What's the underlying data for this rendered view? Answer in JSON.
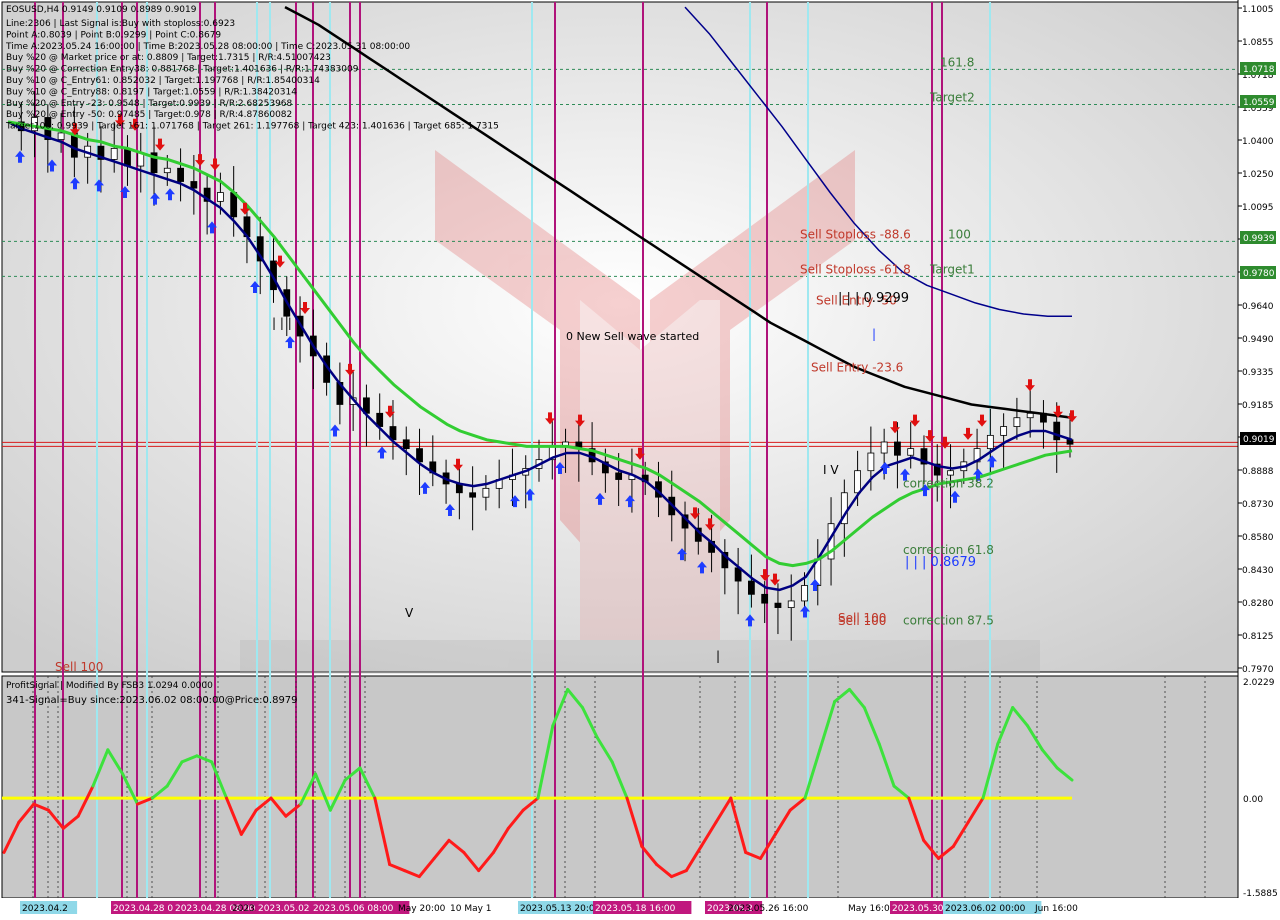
{
  "chart_data": [
    {
      "type": "candlestick",
      "symbol_header": "EOSUSD,H4 0.9149 0.9109 0.8989 0.9019",
      "info_lines": [
        "Line:2306 | Last Signal is:Buy with stoploss:0.6923",
        "Point A:0.8039 | Point B:0.9299 | Point C:0.8679",
        "Time A:2023.05.24 16:00:00 | Time B:2023.05.28 08:00:00 | Time C:2023.05.31 08:00:00",
        "Buy %20 @ Market price or at: 0.8809 | Target:1.7315 | R/R:4.51007423",
        "Buy %20 @ Correction Entry38: 0.881768 | Target:1.401636 | R/R:1.74383009",
        "Buy %10 @ C_Entry61: 0.852032 | Target:1.197768 | R/R:1.85400314",
        "Buy %10 @ C_Entry88: 0.8197 | Target:1.0559 | R/R:1.38420314",
        "Buy %20 @ Entry -23: 0.9548 | Target:0.9939 | R/R:2.68253968",
        "Buy %20 @ Entry -50: 0.97485 | Target:0.978 | R/R:4.87860082",
        "Target100: 0.9939 | Target 161: 1.071768 | Target 261: 1.197768 | Target 423: 1.401636 | Target 685: 1.7315"
      ],
      "y_ticks": [
        "1.1005",
        "1.0855",
        "1.0718",
        "1.0559",
        "1.0400",
        "1.0250",
        "1.0095",
        "0.9939",
        "0.9780",
        "0.9640",
        "0.9490",
        "0.9335",
        "0.9185",
        "0.9019",
        "0.8888",
        "0.8730",
        "0.8580",
        "0.8430",
        "0.8280",
        "0.8125",
        "0.7970"
      ],
      "y_range": [
        0.797,
        1.1005
      ],
      "current_price": "0.9019",
      "price_labels": [
        "1.0718",
        "1.0559",
        "0.9939",
        "0.9780",
        "0.9019"
      ],
      "levels": [
        {
          "label": "161.8",
          "price": 1.0718
        },
        {
          "label": "Target2",
          "price": 1.0559
        },
        {
          "label": "Sell Stoploss -88.6",
          "price": 0.9939
        },
        {
          "label": "100",
          "price": 0.9939
        },
        {
          "label": "Target1",
          "price": 0.978
        },
        {
          "label": "Sell Stoploss -61.8",
          "price": 0.978
        },
        {
          "label": "Sell Entry -50",
          "price": 0.964
        },
        {
          "label": "Sell Entry -23.6",
          "price": 0.9335
        },
        {
          "label": "correction 38.2",
          "price": 0.881
        },
        {
          "label": "correction 61.8",
          "price": 0.851
        },
        {
          "label": "correction 87.5",
          "price": 0.819
        },
        {
          "label": "Sell 100",
          "price": 0.82
        }
      ],
      "annotations": [
        "0 New Sell wave started",
        "| | | 0.9299",
        "| | | 0.8679",
        "Sell 100",
        "Sell 100",
        "| | |",
        "I V",
        "V",
        "|",
        "|"
      ],
      "close_series": [
        1.048,
        1.044,
        1.05,
        1.04,
        1.043,
        1.032,
        1.037,
        1.031,
        1.036,
        1.028,
        1.034,
        1.025,
        1.027,
        1.021,
        1.018,
        1.012,
        1.016,
        1.005,
        0.996,
        0.985,
        0.972,
        0.96,
        0.951,
        0.942,
        0.93,
        0.92,
        0.923,
        0.916,
        0.91,
        0.904,
        0.9,
        0.894,
        0.889,
        0.884,
        0.88,
        0.878,
        0.882,
        0.886,
        0.888,
        0.891,
        0.895,
        0.901,
        0.903,
        0.9,
        0.894,
        0.889,
        0.886,
        0.888,
        0.885,
        0.878,
        0.87,
        0.864,
        0.858,
        0.853,
        0.846,
        0.84,
        0.834,
        0.83,
        0.828,
        0.831,
        0.838,
        0.85,
        0.866,
        0.88,
        0.89,
        0.898,
        0.903,
        0.897,
        0.9,
        0.893,
        0.888,
        0.89,
        0.894,
        0.9,
        0.906,
        0.91,
        0.914,
        0.916,
        0.912,
        0.904,
        0.902
      ],
      "indicator_lines": [
        {
          "name": "fast",
          "color": "#000080",
          "values": [
            1.048,
            1.045,
            1.043,
            1.041,
            1.039,
            1.036,
            1.034,
            1.032,
            1.03,
            1.028,
            1.026,
            1.024,
            1.022,
            1.02,
            1.017,
            1.013,
            1.009,
            1.003,
            0.996,
            0.987,
            0.977,
            0.966,
            0.956,
            0.946,
            0.937,
            0.929,
            0.922,
            0.915,
            0.909,
            0.903,
            0.898,
            0.893,
            0.889,
            0.886,
            0.884,
            0.883,
            0.884,
            0.886,
            0.888,
            0.89,
            0.893,
            0.896,
            0.898,
            0.898,
            0.896,
            0.893,
            0.89,
            0.888,
            0.885,
            0.88,
            0.874,
            0.868,
            0.862,
            0.857,
            0.851,
            0.846,
            0.841,
            0.837,
            0.836,
            0.838,
            0.842,
            0.851,
            0.861,
            0.871,
            0.88,
            0.887,
            0.892,
            0.894,
            0.896,
            0.894,
            0.892,
            0.891,
            0.892,
            0.895,
            0.899,
            0.903,
            0.906,
            0.908,
            0.908,
            0.906,
            0.904
          ]
        },
        {
          "name": "mid",
          "color": "#32cd32",
          "values": [
            1.048,
            1.047,
            1.046,
            1.045,
            1.044,
            1.042,
            1.04,
            1.039,
            1.037,
            1.036,
            1.034,
            1.032,
            1.031,
            1.029,
            1.027,
            1.024,
            1.021,
            1.016,
            1.01,
            1.003,
            0.996,
            0.988,
            0.98,
            0.972,
            0.964,
            0.956,
            0.948,
            0.941,
            0.935,
            0.929,
            0.924,
            0.919,
            0.915,
            0.911,
            0.908,
            0.906,
            0.904,
            0.903,
            0.902,
            0.901,
            0.901,
            0.901,
            0.901,
            0.9,
            0.899,
            0.897,
            0.895,
            0.893,
            0.891,
            0.888,
            0.884,
            0.88,
            0.876,
            0.871,
            0.866,
            0.861,
            0.856,
            0.851,
            0.848,
            0.847,
            0.848,
            0.85,
            0.854,
            0.859,
            0.864,
            0.869,
            0.873,
            0.877,
            0.88,
            0.882,
            0.884,
            0.885,
            0.886,
            0.887,
            0.889,
            0.891,
            0.893,
            0.895,
            0.897,
            0.898,
            0.899
          ]
        },
        {
          "name": "slow",
          "color": "#000000",
          "values": [
            1.1,
            1.096,
            1.092,
            1.087,
            1.082,
            1.077,
            1.072,
            1.067,
            1.062,
            1.057,
            1.052,
            1.047,
            1.042,
            1.037,
            1.032,
            1.027,
            1.022,
            1.017,
            1.012,
            1.007,
            1.002,
            0.997,
            0.992,
            0.987,
            0.982,
            0.977,
            0.972,
            0.967,
            0.962,
            0.957,
            0.953,
            0.949,
            0.945,
            0.941,
            0.937,
            0.934,
            0.931,
            0.928,
            0.926,
            0.924,
            0.922,
            0.92,
            0.919,
            0.918,
            0.917,
            0.916,
            0.915,
            0.914
          ]
        },
        {
          "name": "upper",
          "color": "#00008b",
          "values": [
            1.1,
            1.088,
            1.074,
            1.06,
            1.046,
            1.031,
            1.016,
            1.002,
            0.99,
            0.98,
            0.974,
            0.97,
            0.966,
            0.963,
            0.961,
            0.96,
            0.96
          ]
        }
      ],
      "x_labels": [
        "2023.04.2",
        "2023.04.28 00",
        "2023.04.28 08:00",
        "2023.04.",
        "2023.05.02 0",
        "2023.05.06 08:00",
        "May 20:00",
        "10 May 1",
        "2023.05.13 20:00",
        "2023.05.18 16:00",
        "2023.05.2",
        "2023.05.26 16:00",
        "May 16:00",
        "2023.05.30",
        "2023.06.02 00:00",
        "Jun 16:00"
      ]
    },
    {
      "type": "line",
      "title": "ProfitSignal | Modified By FSB3 1.0294 0.0000",
      "subtitle": "341-Signal=Buy since:2023.06.02 08:00:00@Price:0.8979",
      "y_ticks": [
        "2.0229",
        "0.00",
        "-1.5885"
      ],
      "y_range": [
        -1.5885,
        2.0229
      ],
      "zero_line_color": "#ffff00",
      "values": [
        -0.9,
        -0.4,
        -0.1,
        -0.2,
        -0.5,
        -0.3,
        0.2,
        0.8,
        0.4,
        -0.1,
        0.0,
        0.2,
        0.6,
        0.7,
        0.6,
        0.0,
        -0.6,
        -0.2,
        0.0,
        -0.3,
        -0.1,
        0.4,
        -0.2,
        0.3,
        0.5,
        0.0,
        -1.1,
        -1.2,
        -1.3,
        -1.0,
        -0.7,
        -0.9,
        -1.2,
        -0.9,
        -0.5,
        -0.2,
        0.0,
        1.2,
        1.8,
        1.5,
        1.0,
        0.6,
        0.0,
        -0.8,
        -1.1,
        -1.3,
        -1.2,
        -0.8,
        -0.4,
        0.0,
        -0.9,
        -1.0,
        -0.6,
        -0.2,
        0.0,
        0.8,
        1.6,
        1.8,
        1.5,
        0.9,
        0.2,
        0.0,
        -0.7,
        -1.0,
        -0.8,
        -0.4,
        0.0,
        0.9,
        1.5,
        1.2,
        0.8,
        0.5,
        0.3
      ]
    }
  ]
}
